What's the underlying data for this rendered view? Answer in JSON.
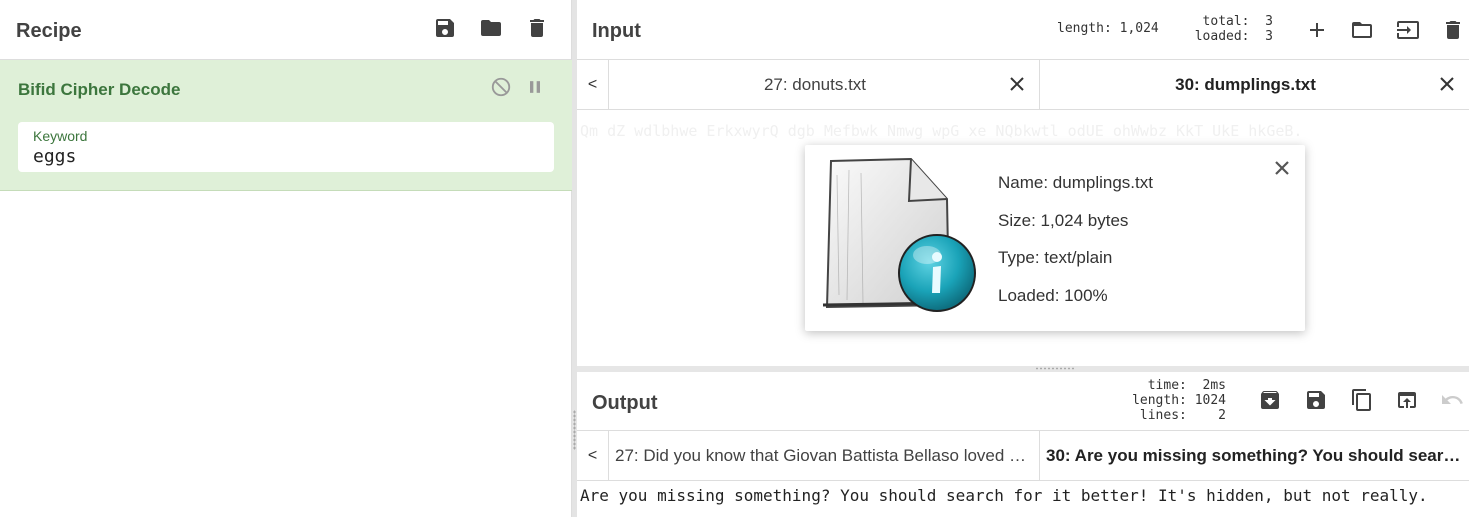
{
  "recipe": {
    "title": "Recipe",
    "icons": [
      "save-icon",
      "folder-icon",
      "trash-icon"
    ],
    "operation": {
      "name": "Bifid Cipher Decode",
      "field_label": "Keyword",
      "field_value": "eggs"
    }
  },
  "input": {
    "title": "Input",
    "stats": {
      "length": "length: 1,024",
      "total": "total:  3",
      "loaded": "loaded:  3"
    },
    "tabs": [
      {
        "label": "27: donuts.txt",
        "active": false
      },
      {
        "label": "30: dumplings.txt",
        "active": true
      }
    ],
    "prev_label": "<",
    "faint_text": "Qm dZ wdlbhwe ErkxwyrQ dgb Mefbwk Nmwg wpG xe NQbkwtl odUE ohWwbz KkT UkE hkGeB.",
    "file": {
      "name": "Name: dumplings.txt",
      "size": "Size: 1,024 bytes",
      "type": "Type: text/plain",
      "loaded": "Loaded: 100%"
    }
  },
  "output": {
    "title": "Output",
    "stats": {
      "time": "time:  2ms",
      "length": "length: 1024",
      "lines": "lines:    2"
    },
    "tabs": [
      {
        "label": "27: Did you know that Giovan Battista Bellaso loved …",
        "active": false
      },
      {
        "label": "30: Are you missing something? You should sear…",
        "active": true
      }
    ],
    "prev_label": "<",
    "text": "Are you missing something? You should search for it better! It's hidden, but not really."
  },
  "colors": {
    "operation_bg": "#dff0d8",
    "operation_text": "#3c763d",
    "info_icon": "#1aa3b8"
  }
}
